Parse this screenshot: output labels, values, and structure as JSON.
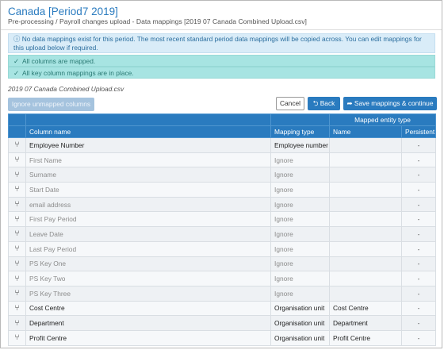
{
  "header": {
    "title": "Canada [Period7 2019]",
    "subtitle": "Pre-processing / Payroll changes upload - Data mappings [2019 07 Canada Combined Upload.csv]"
  },
  "info_message": "No data mappings exist for this period. The most recent standard period data mappings will be copied across. You can edit mappings for this upload below if required.",
  "success_messages": [
    "All columns are mapped.",
    "All key column mappings are in place."
  ],
  "file_name": "2019 07 Canada Combined Upload.csv",
  "buttons": {
    "ignore_unmapped": "Ignore unmapped columns",
    "cancel": "Cancel",
    "back": "Back",
    "save": "Save mappings & continue"
  },
  "table": {
    "headers": {
      "column_name": "Column name",
      "mapping_type": "Mapping type",
      "mapped_entity_type": "Mapped entity type",
      "name": "Name",
      "persistent": "Persistent"
    },
    "rows": [
      {
        "column": "Employee Number",
        "mapping": "Employee number",
        "name": "",
        "persistent": "-",
        "active": true
      },
      {
        "column": "First Name",
        "mapping": "Ignore",
        "name": "",
        "persistent": "-",
        "active": false
      },
      {
        "column": "Surname",
        "mapping": "Ignore",
        "name": "",
        "persistent": "-",
        "active": false
      },
      {
        "column": "Start Date",
        "mapping": "Ignore",
        "name": "",
        "persistent": "-",
        "active": false
      },
      {
        "column": "email address",
        "mapping": "Ignore",
        "name": "",
        "persistent": "-",
        "active": false
      },
      {
        "column": "First Pay Period",
        "mapping": "Ignore",
        "name": "",
        "persistent": "-",
        "active": false
      },
      {
        "column": "Leave Date",
        "mapping": "Ignore",
        "name": "",
        "persistent": "-",
        "active": false
      },
      {
        "column": "Last Pay Period",
        "mapping": "Ignore",
        "name": "",
        "persistent": "-",
        "active": false
      },
      {
        "column": "PS Key One",
        "mapping": "Ignore",
        "name": "",
        "persistent": "-",
        "active": false
      },
      {
        "column": "PS Key Two",
        "mapping": "Ignore",
        "name": "",
        "persistent": "-",
        "active": false
      },
      {
        "column": "PS Key Three",
        "mapping": "Ignore",
        "name": "",
        "persistent": "-",
        "active": false
      },
      {
        "column": "Cost Centre",
        "mapping": "Organisation unit",
        "name": "Cost Centre",
        "persistent": "-",
        "active": true
      },
      {
        "column": "Department",
        "mapping": "Organisation unit",
        "name": "Department",
        "persistent": "-",
        "active": true
      },
      {
        "column": "Profit Centre",
        "mapping": "Organisation unit",
        "name": "Profit Centre",
        "persistent": "-",
        "active": true
      }
    ]
  },
  "colors": {
    "accent": "#2a7bbf",
    "info_bg": "#d9ecf8",
    "success_bg": "#a7e4e2"
  }
}
